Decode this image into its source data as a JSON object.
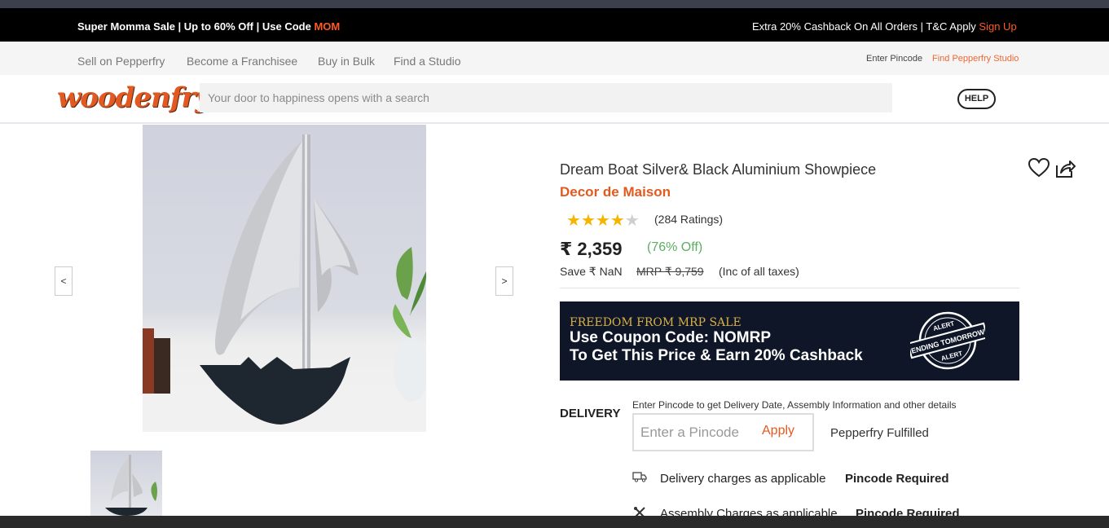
{
  "promo": {
    "left_text": "Super Momma Sale | Up to 60% Off | Use Code ",
    "left_code": "MOM",
    "right_text": "Extra 20% Cashback On All Orders | T&C Apply ",
    "right_link": "Sign Up"
  },
  "util": {
    "links": [
      "Sell on Pepperfry",
      "Become a Franchisee",
      "Buy in Bulk",
      "Find a Studio"
    ],
    "pincode": "Enter Pincode",
    "studio": "Find Pepperfry Studio"
  },
  "header": {
    "logo": "woodenfry",
    "search_placeholder": "Your door to happiness opens with a search",
    "help": "HELP"
  },
  "gallery": {
    "prev": "<",
    "next": ">"
  },
  "product": {
    "title": "Dream Boat Silver& Black Aluminium Showpiece",
    "brand": "Decor de Maison",
    "rating_stars": 4,
    "ratings_text": "(284 Ratings)",
    "price": "₹ 2,359",
    "off": "(76% Off)",
    "save": "Save ₹ NaN",
    "mrp": "MRP ₹ 9,759",
    "tax": "(Inc of all taxes)"
  },
  "banner": {
    "line1": "FREEDOM FROM MRP SALE",
    "line2": "Use Coupon Code: NOMRP",
    "line3": "To Get This Price & Earn 20% Cashback",
    "seal_top": "ALERT",
    "seal_mid": "ENDING TOMORROW",
    "seal_bottom": "ALERT"
  },
  "delivery": {
    "label": "DELIVERY",
    "info": "Enter Pincode to get Delivery Date, Assembly Information and other details",
    "placeholder": "Enter a Pincode",
    "apply": "Apply",
    "fulfilled": "Pepperfry Fulfilled",
    "row1_text": "Delivery charges as applicable",
    "row1_req": "Pincode Required",
    "row2_text": "Assembly Charges as applicable",
    "row2_req": "Pincode Required"
  },
  "colors": {
    "accent": "#e35a1f",
    "promo_code": "#ff5a1f",
    "discount": "#5bae63",
    "star": "#f5b400"
  }
}
